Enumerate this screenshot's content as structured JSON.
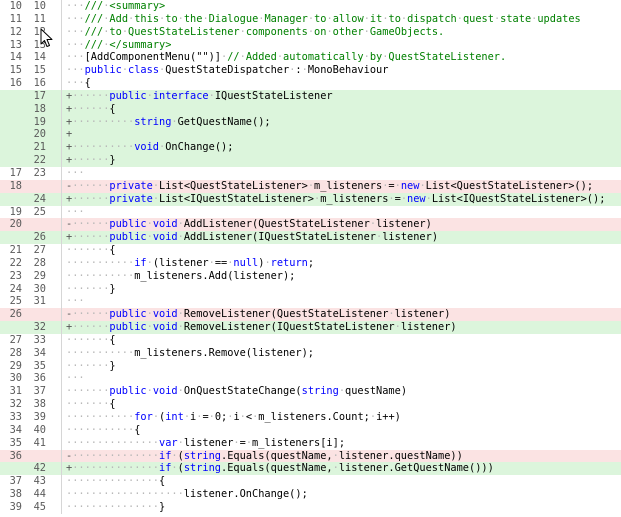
{
  "diff": {
    "rows": [
      {
        "old": "10",
        "new": "10",
        "type": "ctx",
        "marker": "",
        "indent": 3,
        "tokens": [
          [
            "cm",
            "///"
          ],
          [
            "ws",
            "·"
          ],
          [
            "cm",
            "<summary>"
          ]
        ]
      },
      {
        "old": "11",
        "new": "11",
        "type": "ctx",
        "marker": "",
        "indent": 3,
        "tokens": [
          [
            "cm",
            "///"
          ],
          [
            "ws",
            "·"
          ],
          [
            "cm",
            "Add"
          ],
          [
            "ws",
            "·"
          ],
          [
            "cm",
            "this"
          ],
          [
            "ws",
            "·"
          ],
          [
            "cm",
            "to"
          ],
          [
            "ws",
            "·"
          ],
          [
            "cm",
            "the"
          ],
          [
            "ws",
            "·"
          ],
          [
            "cm",
            "Dialogue"
          ],
          [
            "ws",
            "·"
          ],
          [
            "cm",
            "Manager"
          ],
          [
            "ws",
            "·"
          ],
          [
            "cm",
            "to"
          ],
          [
            "ws",
            "·"
          ],
          [
            "cm",
            "allow"
          ],
          [
            "ws",
            "·"
          ],
          [
            "cm",
            "it"
          ],
          [
            "ws",
            "·"
          ],
          [
            "cm",
            "to"
          ],
          [
            "ws",
            "·"
          ],
          [
            "cm",
            "dispatch"
          ],
          [
            "ws",
            "·"
          ],
          [
            "cm",
            "quest"
          ],
          [
            "ws",
            "·"
          ],
          [
            "cm",
            "state"
          ],
          [
            "ws",
            "·"
          ],
          [
            "cm",
            "updates"
          ]
        ]
      },
      {
        "old": "12",
        "new": "12",
        "type": "ctx",
        "marker": "",
        "indent": 3,
        "tokens": [
          [
            "cm",
            "///"
          ],
          [
            "ws",
            "·"
          ],
          [
            "cm",
            "to"
          ],
          [
            "ws",
            "·"
          ],
          [
            "cm",
            "QuestStateListener"
          ],
          [
            "ws",
            "·"
          ],
          [
            "cm",
            "components"
          ],
          [
            "ws",
            "·"
          ],
          [
            "cm",
            "on"
          ],
          [
            "ws",
            "·"
          ],
          [
            "cm",
            "other"
          ],
          [
            "ws",
            "·"
          ],
          [
            "cm",
            "GameObjects."
          ]
        ]
      },
      {
        "old": "13",
        "new": "13",
        "type": "ctx",
        "marker": "",
        "indent": 3,
        "tokens": [
          [
            "cm",
            "///"
          ],
          [
            "ws",
            "·"
          ],
          [
            "cm",
            "</summary>"
          ]
        ]
      },
      {
        "old": "14",
        "new": "14",
        "type": "ctx",
        "marker": "",
        "indent": 3,
        "tokens": [
          [
            "pl",
            "[AddComponentMenu(\"\")]"
          ],
          [
            "ws",
            "·"
          ],
          [
            "cm",
            "//"
          ],
          [
            "ws",
            "·"
          ],
          [
            "cm",
            "Added"
          ],
          [
            "ws",
            "·"
          ],
          [
            "cm",
            "automatically"
          ],
          [
            "ws",
            "·"
          ],
          [
            "cm",
            "by"
          ],
          [
            "ws",
            "·"
          ],
          [
            "cm",
            "QuestStateListener."
          ]
        ]
      },
      {
        "old": "15",
        "new": "15",
        "type": "ctx",
        "marker": "",
        "indent": 3,
        "tokens": [
          [
            "kw",
            "public"
          ],
          [
            "ws",
            "·"
          ],
          [
            "kw",
            "class"
          ],
          [
            "ws",
            "·"
          ],
          [
            "pl",
            "QuestStateDispatcher"
          ],
          [
            "ws",
            "·"
          ],
          [
            "pl",
            ":"
          ],
          [
            "ws",
            "·"
          ],
          [
            "pl",
            "MonoBehaviour"
          ]
        ]
      },
      {
        "old": "16",
        "new": "16",
        "type": "ctx",
        "marker": "",
        "indent": 3,
        "tokens": [
          [
            "pl",
            "{"
          ]
        ]
      },
      {
        "old": "",
        "new": "17",
        "type": "add",
        "marker": "+",
        "indent": 7,
        "tokens": [
          [
            "kw",
            "public"
          ],
          [
            "ws",
            "·"
          ],
          [
            "kw",
            "interface"
          ],
          [
            "ws",
            "·"
          ],
          [
            "pl",
            "IQuestStateListener"
          ]
        ]
      },
      {
        "old": "",
        "new": "18",
        "type": "add",
        "marker": "+",
        "indent": 7,
        "tokens": [
          [
            "pl",
            "{"
          ]
        ]
      },
      {
        "old": "",
        "new": "19",
        "type": "add",
        "marker": "+",
        "indent": 11,
        "tokens": [
          [
            "kw",
            "string"
          ],
          [
            "ws",
            "·"
          ],
          [
            "pl",
            "GetQuestName();"
          ]
        ]
      },
      {
        "old": "",
        "new": "20",
        "type": "add",
        "marker": "+",
        "indent": 0,
        "tokens": []
      },
      {
        "old": "",
        "new": "21",
        "type": "add",
        "marker": "+",
        "indent": 11,
        "tokens": [
          [
            "kw",
            "void"
          ],
          [
            "ws",
            "·"
          ],
          [
            "pl",
            "OnChange();"
          ]
        ]
      },
      {
        "old": "",
        "new": "22",
        "type": "add",
        "marker": "+",
        "indent": 7,
        "tokens": [
          [
            "pl",
            "}"
          ]
        ]
      },
      {
        "old": "17",
        "new": "23",
        "type": "ctx",
        "marker": "",
        "indent": 0,
        "tokens": [
          [
            "ws",
            "···"
          ]
        ]
      },
      {
        "old": "18",
        "new": "",
        "type": "del",
        "marker": "-",
        "indent": 7,
        "tokens": [
          [
            "kw",
            "private"
          ],
          [
            "ws",
            "·"
          ],
          [
            "pl",
            "List<QuestStateListener>"
          ],
          [
            "ws",
            "·"
          ],
          [
            "pl",
            "m_listeners"
          ],
          [
            "ws",
            "·"
          ],
          [
            "pl",
            "="
          ],
          [
            "ws",
            "·"
          ],
          [
            "kw",
            "new"
          ],
          [
            "ws",
            "·"
          ],
          [
            "pl",
            "List<QuestStateListener>();"
          ]
        ]
      },
      {
        "old": "",
        "new": "24",
        "type": "add",
        "marker": "+",
        "indent": 7,
        "tokens": [
          [
            "kw",
            "private"
          ],
          [
            "ws",
            "·"
          ],
          [
            "pl",
            "List<IQuestStateListener>"
          ],
          [
            "ws",
            "·"
          ],
          [
            "pl",
            "m_listeners"
          ],
          [
            "ws",
            "·"
          ],
          [
            "pl",
            "="
          ],
          [
            "ws",
            "·"
          ],
          [
            "kw",
            "new"
          ],
          [
            "ws",
            "·"
          ],
          [
            "pl",
            "List<IQuestStateListener>();"
          ]
        ]
      },
      {
        "old": "19",
        "new": "25",
        "type": "ctx",
        "marker": "",
        "indent": 0,
        "tokens": [
          [
            "ws",
            "···"
          ]
        ]
      },
      {
        "old": "20",
        "new": "",
        "type": "del",
        "marker": "-",
        "indent": 7,
        "tokens": [
          [
            "kw",
            "public"
          ],
          [
            "ws",
            "·"
          ],
          [
            "kw",
            "void"
          ],
          [
            "ws",
            "·"
          ],
          [
            "pl",
            "AddListener(QuestStateListener"
          ],
          [
            "ws",
            "·"
          ],
          [
            "pl",
            "listener)"
          ]
        ]
      },
      {
        "old": "",
        "new": "26",
        "type": "add",
        "marker": "+",
        "indent": 7,
        "tokens": [
          [
            "kw",
            "public"
          ],
          [
            "ws",
            "·"
          ],
          [
            "kw",
            "void"
          ],
          [
            "ws",
            "·"
          ],
          [
            "pl",
            "AddListener(IQuestStateListener"
          ],
          [
            "ws",
            "·"
          ],
          [
            "pl",
            "listener)"
          ]
        ]
      },
      {
        "old": "21",
        "new": "27",
        "type": "ctx",
        "marker": "",
        "indent": 7,
        "tokens": [
          [
            "pl",
            "{"
          ]
        ]
      },
      {
        "old": "22",
        "new": "28",
        "type": "ctx",
        "marker": "",
        "indent": 11,
        "tokens": [
          [
            "kw",
            "if"
          ],
          [
            "ws",
            "·"
          ],
          [
            "pl",
            "(listener"
          ],
          [
            "ws",
            "·"
          ],
          [
            "pl",
            "=="
          ],
          [
            "ws",
            "·"
          ],
          [
            "kw",
            "null"
          ],
          [
            "pl",
            ")"
          ],
          [
            "ws",
            "·"
          ],
          [
            "kw",
            "return"
          ],
          [
            "pl",
            ";"
          ]
        ]
      },
      {
        "old": "23",
        "new": "29",
        "type": "ctx",
        "marker": "",
        "indent": 11,
        "tokens": [
          [
            "pl",
            "m_listeners.Add(listener);"
          ]
        ]
      },
      {
        "old": "24",
        "new": "30",
        "type": "ctx",
        "marker": "",
        "indent": 7,
        "tokens": [
          [
            "pl",
            "}"
          ]
        ]
      },
      {
        "old": "25",
        "new": "31",
        "type": "ctx",
        "marker": "",
        "indent": 0,
        "tokens": [
          [
            "ws",
            "···"
          ]
        ]
      },
      {
        "old": "26",
        "new": "",
        "type": "del",
        "marker": "-",
        "indent": 7,
        "tokens": [
          [
            "kw",
            "public"
          ],
          [
            "ws",
            "·"
          ],
          [
            "kw",
            "void"
          ],
          [
            "ws",
            "·"
          ],
          [
            "pl",
            "RemoveListener(QuestStateListener"
          ],
          [
            "ws",
            "·"
          ],
          [
            "pl",
            "listener)"
          ]
        ]
      },
      {
        "old": "",
        "new": "32",
        "type": "add",
        "marker": "+",
        "indent": 7,
        "tokens": [
          [
            "kw",
            "public"
          ],
          [
            "ws",
            "·"
          ],
          [
            "kw",
            "void"
          ],
          [
            "ws",
            "·"
          ],
          [
            "pl",
            "RemoveListener(IQuestStateListener"
          ],
          [
            "ws",
            "·"
          ],
          [
            "pl",
            "listener)"
          ]
        ]
      },
      {
        "old": "27",
        "new": "33",
        "type": "ctx",
        "marker": "",
        "indent": 7,
        "tokens": [
          [
            "pl",
            "{"
          ]
        ]
      },
      {
        "old": "28",
        "new": "34",
        "type": "ctx",
        "marker": "",
        "indent": 11,
        "tokens": [
          [
            "pl",
            "m_listeners.Remove(listener);"
          ]
        ]
      },
      {
        "old": "29",
        "new": "35",
        "type": "ctx",
        "marker": "",
        "indent": 7,
        "tokens": [
          [
            "pl",
            "}"
          ]
        ]
      },
      {
        "old": "30",
        "new": "36",
        "type": "ctx",
        "marker": "",
        "indent": 0,
        "tokens": [
          [
            "ws",
            "···"
          ]
        ]
      },
      {
        "old": "31",
        "new": "37",
        "type": "ctx",
        "marker": "",
        "indent": 7,
        "tokens": [
          [
            "kw",
            "public"
          ],
          [
            "ws",
            "·"
          ],
          [
            "kw",
            "void"
          ],
          [
            "ws",
            "·"
          ],
          [
            "pl",
            "OnQuestStateChange("
          ],
          [
            "kw",
            "string"
          ],
          [
            "ws",
            "·"
          ],
          [
            "pl",
            "questName)"
          ]
        ]
      },
      {
        "old": "32",
        "new": "38",
        "type": "ctx",
        "marker": "",
        "indent": 7,
        "tokens": [
          [
            "pl",
            "{"
          ]
        ]
      },
      {
        "old": "33",
        "new": "39",
        "type": "ctx",
        "marker": "",
        "indent": 11,
        "tokens": [
          [
            "kw",
            "for"
          ],
          [
            "ws",
            "·"
          ],
          [
            "pl",
            "("
          ],
          [
            "kw",
            "int"
          ],
          [
            "ws",
            "·"
          ],
          [
            "pl",
            "i"
          ],
          [
            "ws",
            "·"
          ],
          [
            "pl",
            "="
          ],
          [
            "ws",
            "·"
          ],
          [
            "pl",
            "0;"
          ],
          [
            "ws",
            "·"
          ],
          [
            "pl",
            "i"
          ],
          [
            "ws",
            "·"
          ],
          [
            "pl",
            "<"
          ],
          [
            "ws",
            "·"
          ],
          [
            "pl",
            "m_listeners.Count;"
          ],
          [
            "ws",
            "·"
          ],
          [
            "pl",
            "i++)"
          ]
        ]
      },
      {
        "old": "34",
        "new": "40",
        "type": "ctx",
        "marker": "",
        "indent": 11,
        "tokens": [
          [
            "pl",
            "{"
          ]
        ]
      },
      {
        "old": "35",
        "new": "41",
        "type": "ctx",
        "marker": "",
        "indent": 15,
        "tokens": [
          [
            "kw",
            "var"
          ],
          [
            "ws",
            "·"
          ],
          [
            "pl",
            "listener"
          ],
          [
            "ws",
            "·"
          ],
          [
            "pl",
            "="
          ],
          [
            "ws",
            "·"
          ],
          [
            "pl",
            "m_listeners[i];"
          ]
        ]
      },
      {
        "old": "36",
        "new": "",
        "type": "del",
        "marker": "-",
        "indent": 15,
        "tokens": [
          [
            "kw",
            "if"
          ],
          [
            "ws",
            "·"
          ],
          [
            "pl",
            "("
          ],
          [
            "kw",
            "string"
          ],
          [
            "pl",
            ".Equals(questName,"
          ],
          [
            "ws",
            "·"
          ],
          [
            "pl",
            "listener.questName))"
          ]
        ]
      },
      {
        "old": "",
        "new": "42",
        "type": "add",
        "marker": "+",
        "indent": 15,
        "tokens": [
          [
            "kw",
            "if"
          ],
          [
            "ws",
            "·"
          ],
          [
            "pl",
            "("
          ],
          [
            "kw",
            "string"
          ],
          [
            "pl",
            ".Equals(questName,"
          ],
          [
            "ws",
            "·"
          ],
          [
            "pl",
            "listener.GetQuestName()))"
          ]
        ]
      },
      {
        "old": "37",
        "new": "43",
        "type": "ctx",
        "marker": "",
        "indent": 15,
        "tokens": [
          [
            "pl",
            "{"
          ]
        ]
      },
      {
        "old": "38",
        "new": "44",
        "type": "ctx",
        "marker": "",
        "indent": 19,
        "tokens": [
          [
            "pl",
            "listener.OnChange();"
          ]
        ]
      },
      {
        "old": "39",
        "new": "45",
        "type": "ctx",
        "marker": "",
        "indent": 15,
        "tokens": [
          [
            "pl",
            "}"
          ]
        ]
      }
    ]
  },
  "colors": {
    "added_bg": "#dcf5dc",
    "deleted_bg": "#fbe3e3",
    "keyword": "#0000ff",
    "comment": "#008000",
    "whitespace_dot": "#b8b8b8"
  },
  "icons": {
    "cursor": "mouse-pointer-icon"
  }
}
